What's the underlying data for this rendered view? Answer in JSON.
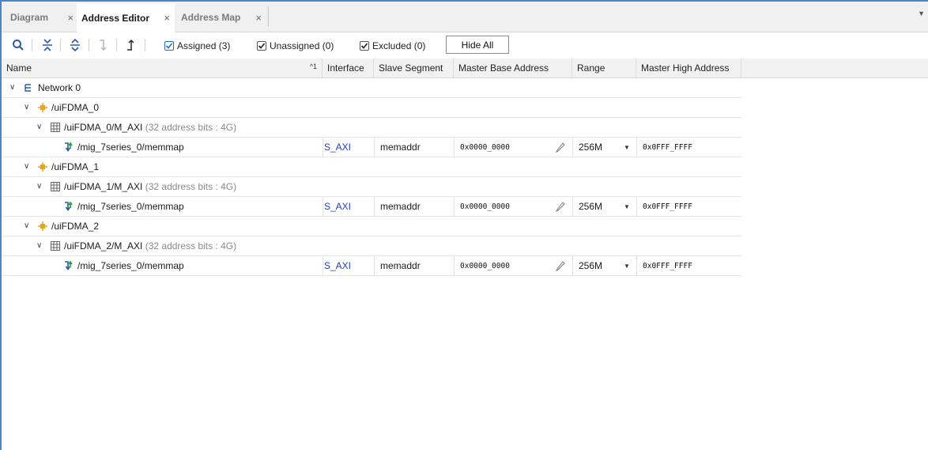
{
  "tabs": [
    {
      "label": "Diagram",
      "close": "×"
    },
    {
      "label": "Address Editor",
      "close": "×"
    },
    {
      "label": "Address Map",
      "close": "×"
    }
  ],
  "toolbar": {
    "filters": [
      {
        "label": "Assigned (3)",
        "checked": true
      },
      {
        "label": "Unassigned (0)",
        "checked": true
      },
      {
        "label": "Excluded (0)",
        "checked": true
      }
    ],
    "hide_all": "Hide All"
  },
  "columns": {
    "name": "Name",
    "sort_indicator": "^1",
    "interface": "Interface",
    "slave_segment": "Slave Segment",
    "master_base_address": "Master Base Address",
    "range": "Range",
    "master_high_address": "Master High Address"
  },
  "tree": {
    "network": "Network 0",
    "masters": [
      {
        "name": "/uiFDMA_0",
        "space": "/uiFDMA_0/M_AXI",
        "space_info": "(32 address bits : 4G)",
        "segment": {
          "name": "/mig_7series_0/memmap",
          "interface": "S_AXI",
          "slave_segment": "memaddr",
          "base": "0x0000_0000",
          "range": "256M",
          "high": "0x0FFF_FFFF"
        }
      },
      {
        "name": "/uiFDMA_1",
        "space": "/uiFDMA_1/M_AXI",
        "space_info": "(32 address bits : 4G)",
        "segment": {
          "name": "/mig_7series_0/memmap",
          "interface": "S_AXI",
          "slave_segment": "memaddr",
          "base": "0x0000_0000",
          "range": "256M",
          "high": "0x0FFF_FFFF"
        }
      },
      {
        "name": "/uiFDMA_2",
        "space": "/uiFDMA_2/M_AXI",
        "space_info": "(32 address bits : 4G)",
        "segment": {
          "name": "/mig_7series_0/memmap",
          "interface": "S_AXI",
          "slave_segment": "memaddr",
          "base": "0x0000_0000",
          "range": "256M",
          "high": "0x0FFF_FFFF"
        }
      }
    ]
  },
  "colors": {
    "accent": "#4a86c6",
    "link": "#1f3fbf",
    "ip_icon": "#e8a317"
  }
}
